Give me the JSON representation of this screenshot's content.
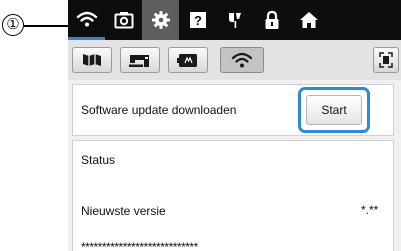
{
  "callout": "①",
  "topbar": {
    "icons": [
      "wifi-icon",
      "camera-icon",
      "gear-icon",
      "help-icon",
      "needle-icon",
      "lock-icon",
      "home-icon"
    ]
  },
  "subbar": {
    "tabs": [
      "embroidery-frame-icon",
      "sewing-machine-icon",
      "embroidery-card-icon",
      "wifi-icon"
    ],
    "right_icon": "screen-capture-icon"
  },
  "update": {
    "label": "Software update downloaden",
    "button": "Start"
  },
  "status": {
    "title": "Status",
    "latest_version_label": "Nieuwste versie",
    "latest_version_value": "*.**",
    "masked": "****************************"
  },
  "colors": {
    "topbar": "#0d0d0d",
    "accent": "#2e88dc",
    "active_tab": "#5e5e5e"
  }
}
